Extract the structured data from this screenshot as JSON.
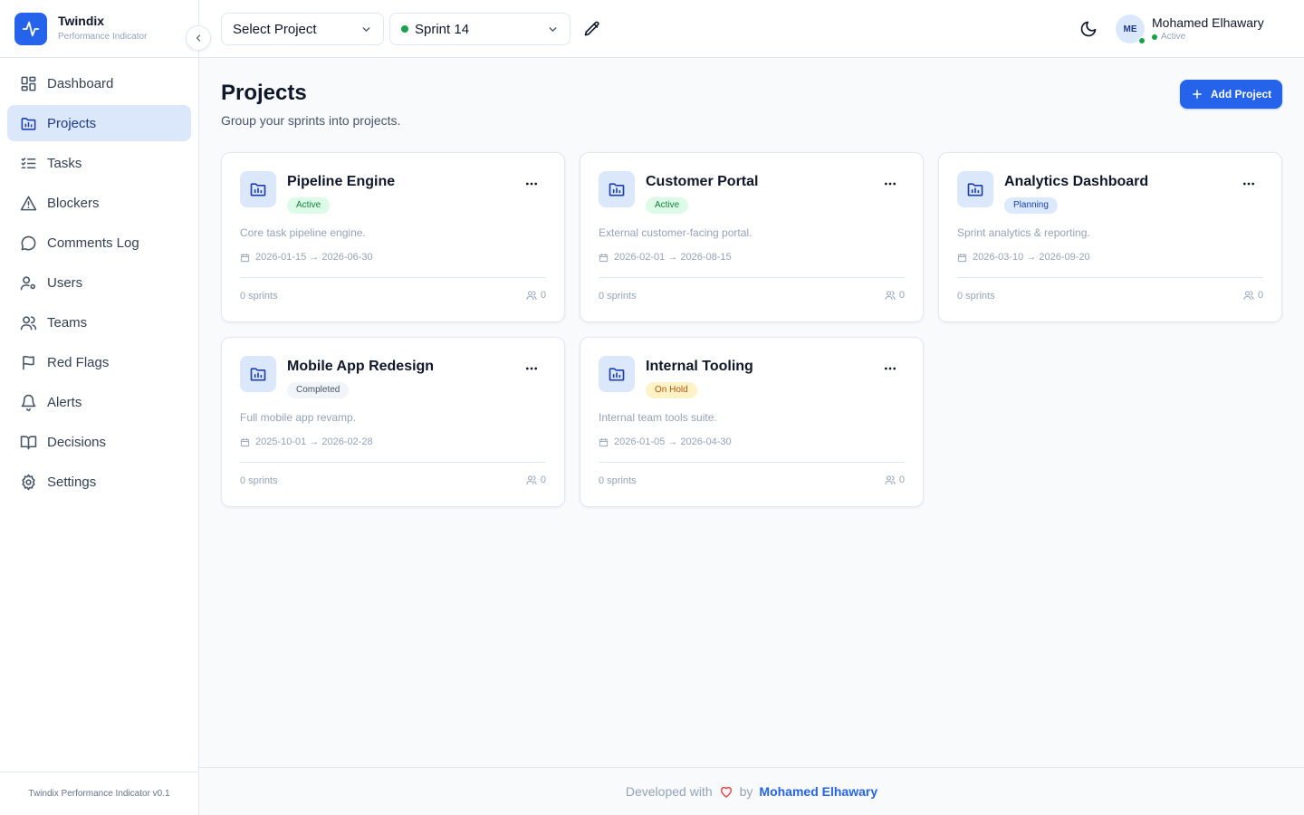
{
  "brand": {
    "title": "Twindix",
    "subtitle": "Performance Indicator"
  },
  "sidebar": {
    "items": [
      {
        "label": "Dashboard",
        "icon": "dashboard-icon",
        "active": false
      },
      {
        "label": "Projects",
        "icon": "folder-chart-icon",
        "active": true
      },
      {
        "label": "Tasks",
        "icon": "list-checks-icon",
        "active": false
      },
      {
        "label": "Blockers",
        "icon": "warning-triangle-icon",
        "active": false
      },
      {
        "label": "Comments Log",
        "icon": "message-circle-icon",
        "active": false
      },
      {
        "label": "Users",
        "icon": "user-gear-icon",
        "active": false
      },
      {
        "label": "Teams",
        "icon": "users-icon",
        "active": false
      },
      {
        "label": "Red Flags",
        "icon": "flag-icon",
        "active": false
      },
      {
        "label": "Alerts",
        "icon": "bell-icon",
        "active": false
      },
      {
        "label": "Decisions",
        "icon": "book-open-icon",
        "active": false
      },
      {
        "label": "Settings",
        "icon": "gear-icon",
        "active": false
      }
    ],
    "footer": "Twindix Performance Indicator v0.1"
  },
  "header": {
    "project_select": "Select Project",
    "sprint_select": "Sprint 14",
    "user": {
      "initials": "ME",
      "name": "Mohamed Elhawary",
      "status": "Active"
    }
  },
  "main": {
    "title": "Projects",
    "subtitle": "Group your sprints into projects.",
    "add_button": "Add Project",
    "projects": [
      {
        "name": "Pipeline Engine",
        "status": "Active",
        "description": "Core task pipeline engine.",
        "dates": "2026-01-15 → 2026-06-30",
        "sprints": "0 sprints",
        "members": "0"
      },
      {
        "name": "Customer Portal",
        "status": "Active",
        "description": "External customer-facing portal.",
        "dates": "2026-02-01 → 2026-08-15",
        "sprints": "0 sprints",
        "members": "0"
      },
      {
        "name": "Analytics Dashboard",
        "status": "Planning",
        "description": "Sprint analytics & reporting.",
        "dates": "2026-03-10 → 2026-09-20",
        "sprints": "0 sprints",
        "members": "0"
      },
      {
        "name": "Mobile App Redesign",
        "status": "Completed",
        "description": "Full mobile app revamp.",
        "dates": "2025-10-01 → 2026-02-28",
        "sprints": "0 sprints",
        "members": "0"
      },
      {
        "name": "Internal Tooling",
        "status": "On Hold",
        "description": "Internal team tools suite.",
        "dates": "2026-01-05 → 2026-04-30",
        "sprints": "0 sprints",
        "members": "0"
      }
    ]
  },
  "footer": {
    "prefix": "Developed with",
    "by": "by",
    "author": "Mohamed Elhawary"
  },
  "colors": {
    "accent": "#2563eb",
    "active_green": "#16a34a",
    "active_nav_bg": "#dbe7fb"
  }
}
